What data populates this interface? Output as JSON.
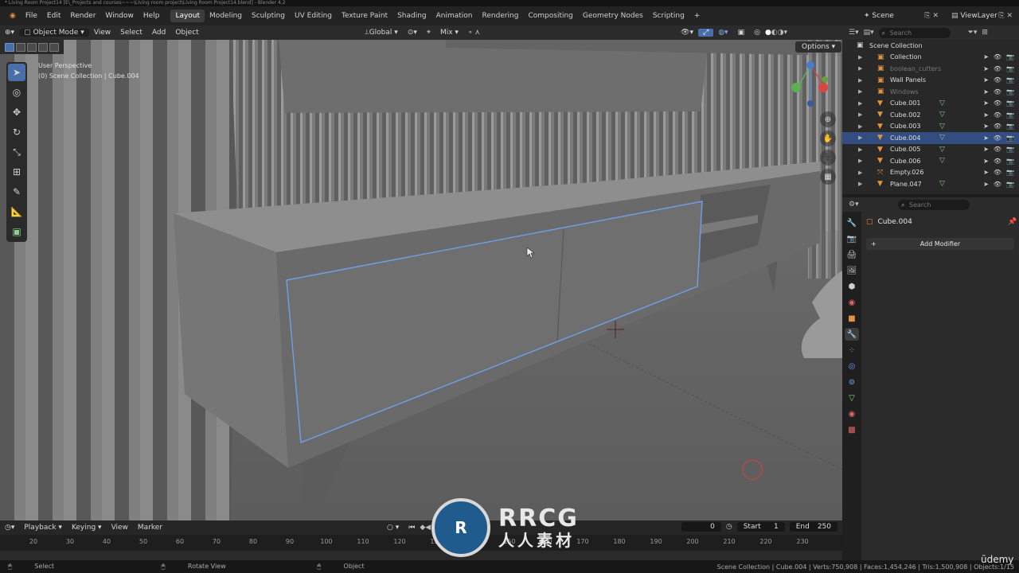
{
  "window": {
    "title": "* Living Room Project14 [E\\_Projects and courses~~~\\Living room project\\Living Room Project14.blend] - Blender 4.2"
  },
  "menubar": {
    "menus": [
      "File",
      "Edit",
      "Render",
      "Window",
      "Help"
    ],
    "workspaces": [
      "Layout",
      "Modeling",
      "Sculpting",
      "UV Editing",
      "Texture Paint",
      "Shading",
      "Animation",
      "Rendering",
      "Compositing",
      "Geometry Nodes",
      "Scripting"
    ],
    "active_workspace": "Layout",
    "add_label": "+",
    "scene": "Scene",
    "view_layer": "ViewLayer"
  },
  "viewport_header": {
    "mode": "Object Mode",
    "menus": [
      "View",
      "Select",
      "Add",
      "Object"
    ],
    "orientation": "Global",
    "snap_mode": "Mix",
    "options_label": "Options"
  },
  "viewport": {
    "perspective_label": "User Perspective",
    "context_label": "(0) Scene Collection | Cube.004"
  },
  "timeline": {
    "menus": [
      "Playback",
      "Keying",
      "View",
      "Marker"
    ],
    "current_frame": "0",
    "start_label": "Start",
    "start_value": "1",
    "end_label": "End",
    "end_value": "250",
    "ruler": [
      "20",
      "30",
      "40",
      "50",
      "60",
      "70",
      "80",
      "90",
      "100",
      "110",
      "120",
      "130",
      "140",
      "150",
      "160",
      "170",
      "180",
      "190",
      "200",
      "210",
      "220",
      "230"
    ]
  },
  "statusbar": {
    "select": "Select",
    "rotate": "Rotate View",
    "object": "Object",
    "stats": "Scene Collection | Cube.004 | Verts:750,908 | Faces:1,454,246 | Tris:1,500,908 | Objects:1/15"
  },
  "outliner": {
    "search_placeholder": "Search",
    "root": "Scene Collection",
    "items": [
      {
        "name": "Collection",
        "type": "collection"
      },
      {
        "name": "boolean_cutters",
        "type": "collection",
        "dim": true
      },
      {
        "name": "Wall Panels",
        "type": "collection"
      },
      {
        "name": "Windows",
        "type": "collection",
        "dim": true
      },
      {
        "name": "Cube.001",
        "type": "mesh"
      },
      {
        "name": "Cube.002",
        "type": "mesh"
      },
      {
        "name": "Cube.003",
        "type": "mesh"
      },
      {
        "name": "Cube.004",
        "type": "mesh",
        "selected": true
      },
      {
        "name": "Cube.005",
        "type": "mesh"
      },
      {
        "name": "Cube.006",
        "type": "mesh"
      },
      {
        "name": "Empty.026",
        "type": "empty"
      },
      {
        "name": "Plane.047",
        "type": "mesh"
      }
    ]
  },
  "properties": {
    "search_placeholder": "Search",
    "object_name": "Cube.004",
    "add_modifier": "Add Modifier"
  },
  "watermark": {
    "logo": "RRCG",
    "subtitle": "人人素材"
  },
  "brand": "ūdemy",
  "colors": {
    "accent": "#4a6ea8",
    "selection": "#334d80",
    "outline": "#6fa0e8"
  }
}
